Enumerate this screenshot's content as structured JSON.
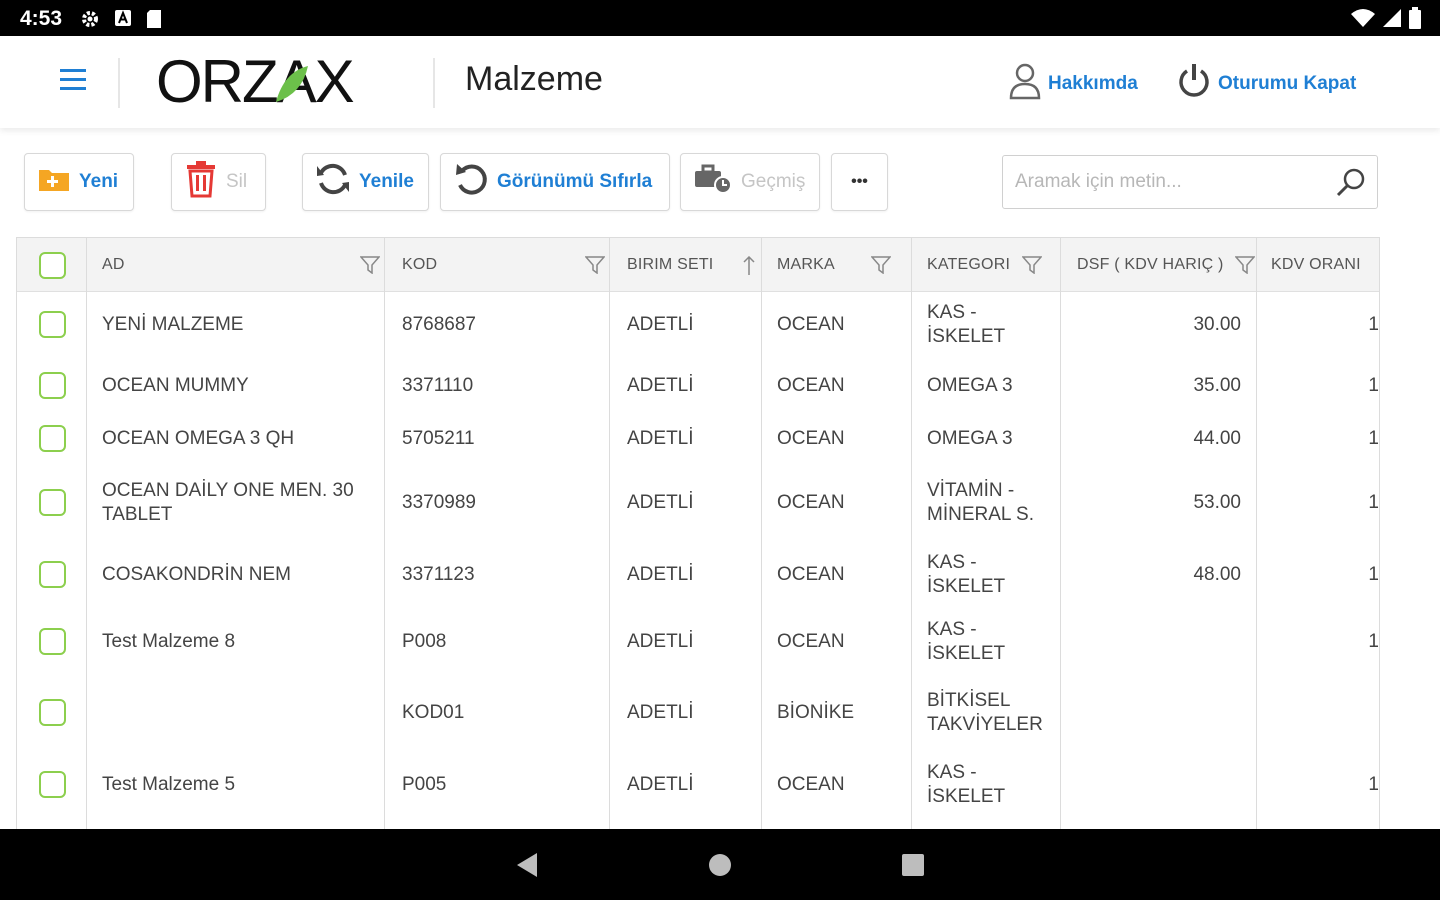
{
  "status_bar": {
    "time": "4:53"
  },
  "header": {
    "logo_text": "ORZAX",
    "title": "Malzeme",
    "about_label": "Hakkımda",
    "logout_label": "Oturumu Kapat"
  },
  "toolbar": {
    "new_label": "Yeni",
    "delete_label": "Sil",
    "refresh_label": "Yenile",
    "reset_view_label": "Görünümü Sıfırla",
    "history_label": "Geçmiş",
    "more_label": "•••",
    "search_placeholder": "Aramak için metin..."
  },
  "grid": {
    "columns": [
      "AD",
      "KOD",
      "BIRIM SETI",
      "MARKA",
      "KATEGORI",
      "DSF ( KDV HARIÇ )",
      "KDV ORANI"
    ],
    "rows": [
      {
        "ad": "YENİ MALZEME",
        "kod": "8768687",
        "birim": "ADETLİ",
        "marka": "OCEAN",
        "kategori": "KAS - İSKELET",
        "dsf": "30.00",
        "kdv": "1"
      },
      {
        "ad": "OCEAN MUMMY",
        "kod": "3371110",
        "birim": "ADETLİ",
        "marka": "OCEAN",
        "kategori": "OMEGA 3",
        "dsf": "35.00",
        "kdv": "1"
      },
      {
        "ad": "OCEAN OMEGA 3 QH",
        "kod": "5705211",
        "birim": "ADETLİ",
        "marka": "OCEAN",
        "kategori": "OMEGA 3",
        "dsf": "44.00",
        "kdv": "1"
      },
      {
        "ad": "OCEAN DAİLY ONE MEN. 30 TABLET",
        "kod": "3370989",
        "birim": "ADETLİ",
        "marka": "OCEAN",
        "kategori": "VİTAMİN - MİNERAL S.",
        "dsf": "53.00",
        "kdv": "1"
      },
      {
        "ad": "COSAKONDRİN NEM",
        "kod": "3371123",
        "birim": "ADETLİ",
        "marka": "OCEAN",
        "kategori": "KAS - İSKELET",
        "dsf": "48.00",
        "kdv": "1"
      },
      {
        "ad": "Test Malzeme 8",
        "kod": "P008",
        "birim": "ADETLİ",
        "marka": "OCEAN",
        "kategori": "KAS - İSKELET",
        "dsf": "",
        "kdv": "1"
      },
      {
        "ad": "",
        "kod": "KOD01",
        "birim": "ADETLİ",
        "marka": "BİONİKE",
        "kategori": "BİTKİSEL TAKVİYELER",
        "dsf": "",
        "kdv": ""
      },
      {
        "ad": "Test Malzeme 5",
        "kod": "P005",
        "birim": "ADETLİ",
        "marka": "OCEAN",
        "kategori": "KAS - İSKELET",
        "dsf": "",
        "kdv": "1"
      }
    ]
  },
  "colors": {
    "accent": "#1f7fd4",
    "checkbox": "#8ccf4d",
    "delete": "#e53935",
    "new": "#f5a623",
    "logo_leaf": "#6cc04a"
  },
  "icons": [
    "settings-icon",
    "a-icon",
    "sd-card-icon",
    "wifi-icon",
    "signal-icon",
    "battery-icon",
    "hamburger-menu-icon",
    "user-icon",
    "power-icon",
    "folder-plus-icon",
    "trash-icon",
    "refresh-icon",
    "undo-icon",
    "history-icon",
    "search-icon",
    "filter-icon",
    "sort-up-icon",
    "nav-back-icon",
    "nav-home-icon",
    "nav-recents-icon"
  ]
}
